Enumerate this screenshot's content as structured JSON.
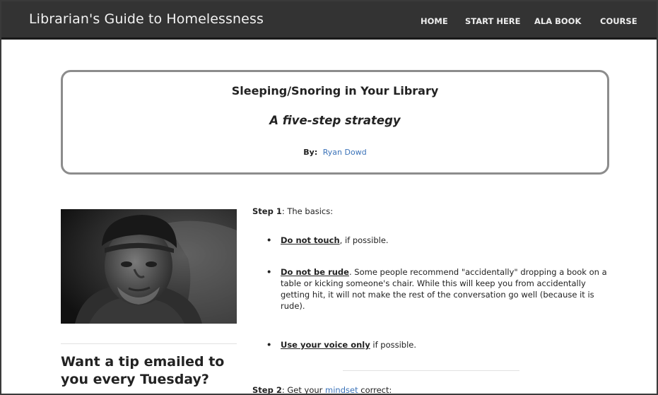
{
  "header": {
    "site_title": "Librarian's Guide to Homelessness",
    "nav": [
      "HOME",
      "START HERE",
      "ALA BOOK",
      "COURSE"
    ]
  },
  "titlebox": {
    "title": "Sleeping/Snoring in Your Library",
    "subtitle": "A five-step strategy",
    "by_label": "By:",
    "author": "Ryan Dowd"
  },
  "sidebar": {
    "cta": "Want a tip emailed to you every Tuesday?"
  },
  "content": {
    "step1_label": "Step 1",
    "step1_text": ":  The basics:",
    "bullets": [
      {
        "lead": "Do not touch",
        "rest": ", if possible."
      },
      {
        "lead": "Do not be rude",
        "rest": ".  Some people recommend \"accidentally\" dropping a book on a table or kicking someone's chair.  While this will keep you from accidentally getting hit, it will not make the rest of the conversation go well (because it is rude)."
      },
      {
        "lead": "Use your voice only",
        "rest": " if possible."
      }
    ],
    "step2_label": "Step 2",
    "step2_pre": ":  Get your ",
    "step2_link": "mindset",
    "step2_post": " correct:"
  },
  "colors": {
    "header_bg": "#333333",
    "link": "#3b73b9",
    "box_border": "#8c8c8c"
  }
}
